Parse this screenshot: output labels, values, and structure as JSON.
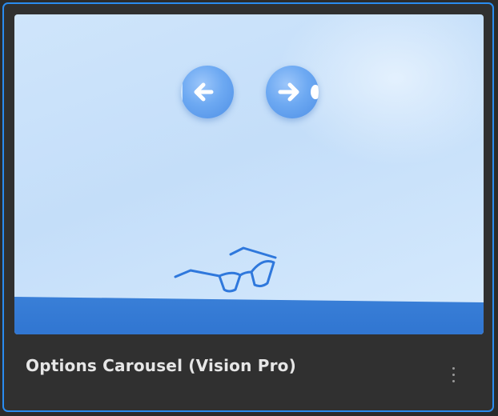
{
  "card": {
    "title": "Options Carousel (Vision Pro)",
    "accent": "#2a8cf0"
  },
  "thumbnail": {
    "prev_icon": "arrow-left-icon",
    "next_icon": "arrow-right-icon",
    "object_icon": "eyeglasses-icon"
  },
  "menu": {
    "icon": "more-vertical-icon"
  }
}
